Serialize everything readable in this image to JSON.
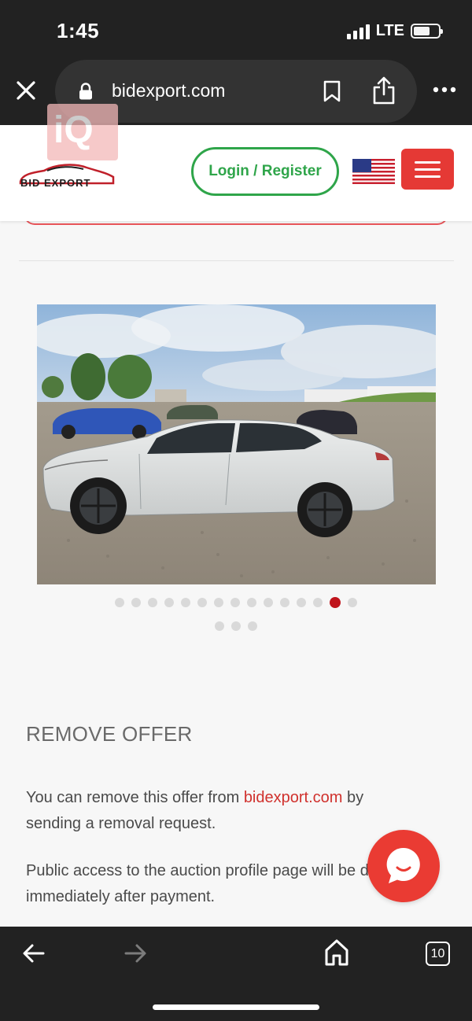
{
  "status_bar": {
    "time": "1:45",
    "network": "LTE"
  },
  "browser": {
    "url": "bidexport.com",
    "tabs_count": "10"
  },
  "header": {
    "watermark": "iQ",
    "logo_text": "BID EXPORT",
    "login_label": "Login / Register",
    "colors": {
      "green": "#2fa54a",
      "red": "#e53935"
    }
  },
  "carousel": {
    "total": 17,
    "active_index": 13
  },
  "remove_offer": {
    "title": "REMOVE OFFER",
    "para1_before": "You can remove this offer from ",
    "para1_link": "bidexport.com",
    "para1_after": " by sending a removal request.",
    "para2": "Public access to the auction profile page will be disabled immediately after payment."
  }
}
